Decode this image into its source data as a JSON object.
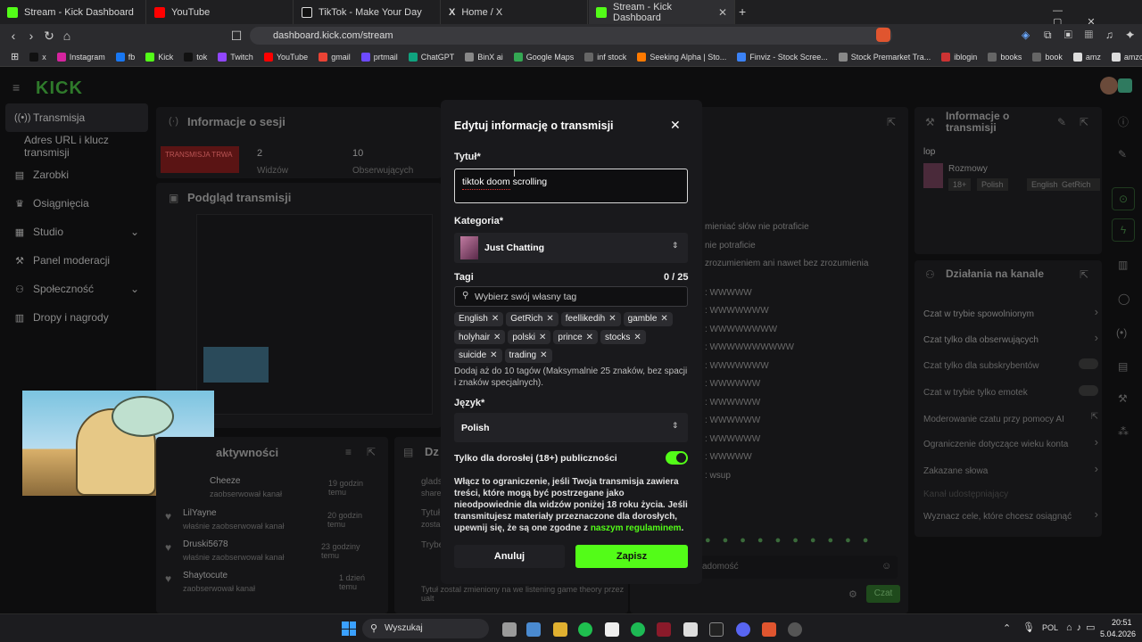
{
  "browser": {
    "tabs": [
      {
        "label": "Stream - Kick Dashboard",
        "icon": "kick-icon",
        "active": false
      },
      {
        "label": "YouTube",
        "icon": "youtube-icon",
        "active": false
      },
      {
        "label": "TikTok - Make Your Day",
        "icon": "tiktok-icon",
        "active": false
      },
      {
        "label": "Home / X",
        "icon": "x-icon",
        "active": false
      },
      {
        "label": "Stream - Kick Dashboard",
        "icon": "kick-icon",
        "active": true
      }
    ],
    "url": "dashboard.kick.com/stream",
    "bookmarks": [
      "x",
      "Instagram",
      "fb",
      "Kick",
      "tok",
      "Twitch",
      "YouTube",
      "gmail",
      "prtmail",
      "ChatGPT",
      "BinX ai",
      "Google Maps",
      "inf stock",
      "Seeking Alpha | Sto...",
      "Finviz - Stock Scree...",
      "Stock Premarket Tra...",
      "iblogin",
      "books",
      "book",
      "amz",
      "amzcom"
    ]
  },
  "brand": {
    "logo": "KICK",
    "accent": "#53fc18"
  },
  "sidebar": {
    "items": [
      {
        "label": "Transmisja",
        "icon": "broadcast-icon"
      },
      {
        "label": "Adres URL i klucz transmisji",
        "icon": ""
      },
      {
        "label": "Zarobki",
        "icon": "wallet-icon"
      },
      {
        "label": "Osiągnięcia",
        "icon": "trophy-icon"
      },
      {
        "label": "Studio",
        "icon": "studio-icon"
      },
      {
        "label": "Panel moderacji",
        "icon": "wrench-icon"
      },
      {
        "label": "Społeczność",
        "icon": "community-icon"
      },
      {
        "label": "Dropy i nagrody",
        "icon": "gift-icon"
      }
    ]
  },
  "session": {
    "title": "Informacje o sesji",
    "live_badge": "TRANSMISJA TRWA",
    "viewers_value": "2",
    "viewers_label": "Widzów",
    "followers_value": "10",
    "followers_label": "Obserwujących"
  },
  "preview": {
    "title": "Podgląd transmisji"
  },
  "activity": {
    "title": "aktywności",
    "feed": [
      {
        "name": "Cheeze",
        "action": "zaobserwował kanał",
        "time": "19 godzin temu"
      },
      {
        "name": "LilYayne",
        "action": "właśnie zaobserwował kanał",
        "time": "20 godzin temu"
      },
      {
        "name": "Druski5678",
        "action": "właśnie zaobserwował kanał",
        "time": "23 godziny temu"
      },
      {
        "name": "Shaytocute",
        "action": "zaobserwował kanał",
        "time": "1 dzień temu"
      }
    ]
  },
  "info_panel": {
    "title": "Informacje o transmisji",
    "stream_title": "lop",
    "category": "Rozmowy",
    "tags": [
      "18+",
      "Polish",
      "English",
      "GetRich"
    ]
  },
  "channel_actions": {
    "title": "Działania na kanale",
    "items": [
      {
        "label": "Czat w trybie spowolnionym",
        "control": "arrow"
      },
      {
        "label": "Czat tylko dla obserwujących",
        "control": "arrow"
      },
      {
        "label": "Czat tylko dla subskrybentów",
        "control": "toggle"
      },
      {
        "label": "Czat w trybie tylko emotek",
        "control": "toggle"
      },
      {
        "label": "Moderowanie czatu przy pomocy AI",
        "control": "external"
      },
      {
        "label": "Ograniczenie dotyczące wieku konta",
        "control": "arrow"
      },
      {
        "label": "Zakazane słowa",
        "control": "arrow"
      },
      {
        "label": "Kanał udostępniający",
        "control": "none"
      },
      {
        "label": "Wyznacz cele, które chcesz osiągnąć",
        "control": "arrow"
      }
    ]
  },
  "chat": {
    "lines": [
      "mieniać słów nie potraficie",
      "nie potraficie",
      "zrozumieniem ani nawet bez zrozumienia",
      ": WWWWW",
      ": WWWWWWW",
      ": WWWWWWWW",
      ": WWWWWWWWWW",
      ": WWWWWWW",
      ": WWWWWW",
      ": WWWWWW",
      ": WWWWWW",
      ": WWWWWW",
      ": WWWWW",
      ": wsup"
    ],
    "input_placeholder": "adomość",
    "send_label": "Czat",
    "other_panel_title": "Dz",
    "other_feed": [
      "glads",
      "share",
      "Tytuł",
      "zosta",
      "Trybe",
      "Tytuł zostal zmieniony na we listening game theory przez ualt"
    ]
  },
  "modal": {
    "title": "Edytuj informację o transmisji",
    "title_label": "Tytuł*",
    "title_value": "tiktok doom scrolling",
    "category_label": "Kategoria*",
    "category_value": "Just Chatting",
    "tags_label": "Tagi",
    "tags_count": "0 / 25",
    "tags_placeholder": "Wybierz swój własny tag",
    "tags": [
      "English",
      "GetRich",
      "feellikedih",
      "gamble",
      "holyhair",
      "polski",
      "prince",
      "stocks",
      "suicide",
      "trading"
    ],
    "tags_help": "Dodaj aż do 10 tagów (Maksymalnie 25 znaków, bez spacji i znaków specjalnych).",
    "language_label": "Język*",
    "language_value": "Polish",
    "adult_label": "Tylko dla dorosłej (18+) publiczności",
    "adult_enabled": true,
    "adult_help": "Włącz to ograniczenie, jeśli Twoja transmisja zawiera treści, które mogą być postrzegane jako nieodpowiednie dla widzów poniżej 18 roku życia. Jeśli transmitujesz materiały przeznaczone dla dorosłych, upewnij się, że są one zgodne z",
    "adult_link": "naszym regulaminem",
    "adult_end": ".",
    "cancel_label": "Anuluj",
    "save_label": "Zapisz"
  },
  "taskbar": {
    "search_placeholder": "Wyszukaj",
    "language": "POL",
    "time": "20:51",
    "date": "5.04.2026"
  }
}
